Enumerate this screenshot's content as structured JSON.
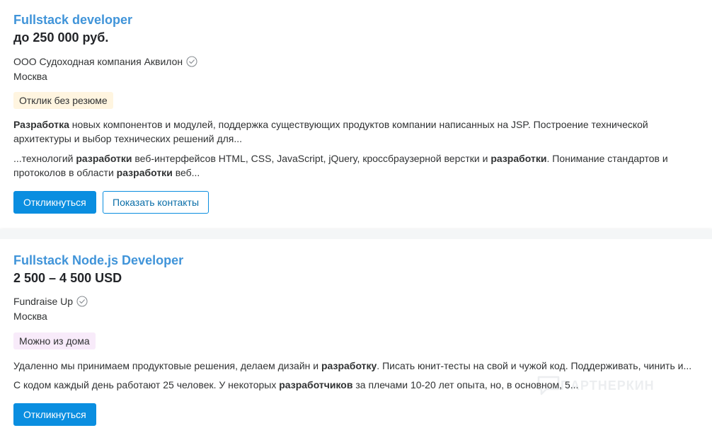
{
  "vacancies": [
    {
      "title": "Fullstack developer",
      "salary": "до 250 000 руб.",
      "company": "ООО Судоходная компания Аквилон",
      "city": "Москва",
      "badge": "Отклик без резюме",
      "snippet1": {
        "part1_bold": "Разработка",
        "part2": " новых компонентов и модулей, поддержка существующих продуктов компании написанных на JSP. Построение технической архитектуры и выбор технических решений для..."
      },
      "snippet2": {
        "part1": "...технологий ",
        "part2_bold": "разработки",
        "part3": " веб-интерфейсов HTML, CSS, JavaScript, jQuery, кроссбраузерной верстки и ",
        "part4_bold": "разработки",
        "part5": ". Понимание стандартов и протоколов в области ",
        "part6_bold": "разработки",
        "part7": " веб..."
      },
      "respond_label": "Откликнуться",
      "contacts_label": "Показать контакты"
    },
    {
      "title": "Fullstack Node.js Developer",
      "salary": "2 500 – 4 500 USD",
      "company": "Fundraise Up",
      "city": "Москва",
      "badge": "Можно из дома",
      "snippet1": {
        "part1": "Удаленно мы принимаем продуктовые решения, делаем дизайн и ",
        "part2_bold": "разработку",
        "part3": ". Писать юнит-тесты на свой и чужой код. Поддерживать, чинить и..."
      },
      "snippet2": {
        "part1": "С кодом каждый день работают 25 человек. У некоторых ",
        "part2_bold": "разработчиков",
        "part3": " за плечами 10-20 лет опыта, но, в основном, 5..."
      },
      "respond_label": "Откликнуться"
    }
  ],
  "watermark": "ПАРТНЕРКИН",
  "icons": {
    "verified": "check-circle-icon",
    "watermark_logo": "speech-bubble-icon"
  },
  "colors": {
    "title": "#4094d9",
    "primary_button": "#0a8ee0",
    "badge_no_resume": "#fff5e0",
    "badge_remote": "#f8ebfa"
  }
}
